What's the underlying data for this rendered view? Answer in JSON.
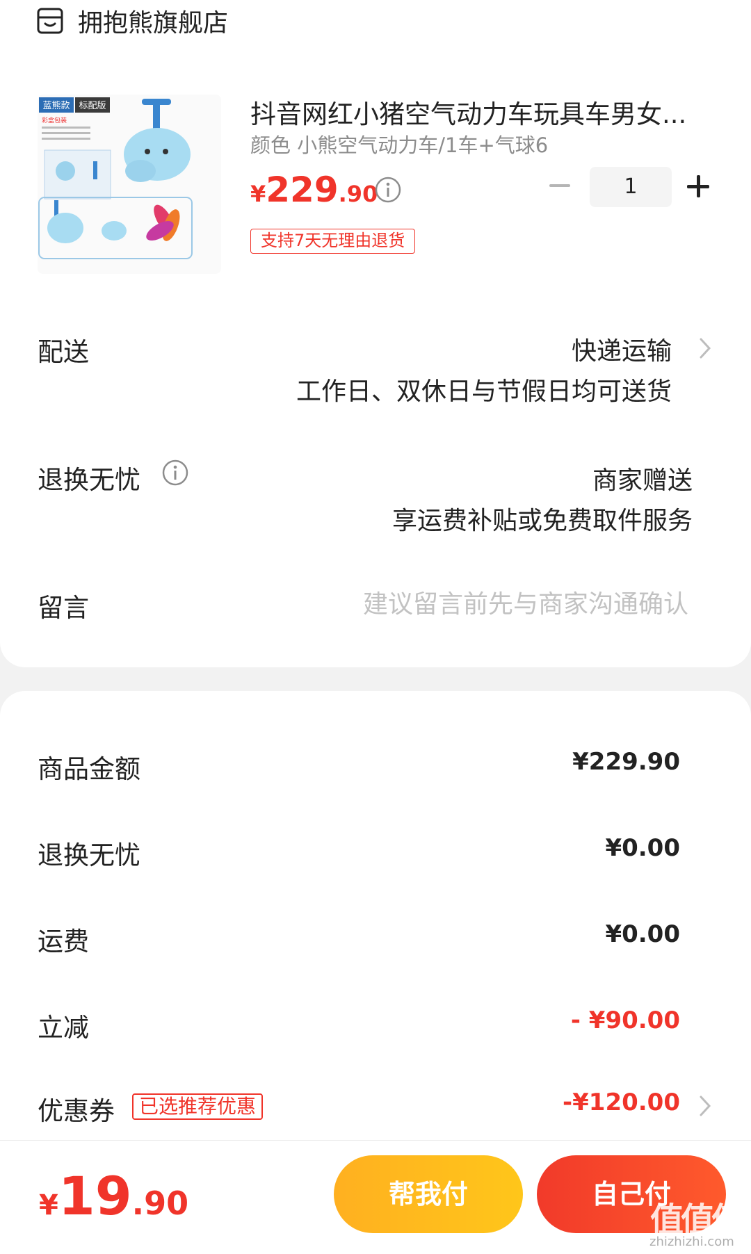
{
  "shop": {
    "name": "拥抱熊旗舰店",
    "icon": "store-icon"
  },
  "product": {
    "title": "抖音网红小猪空气动力车玩具车男女...",
    "spec": "颜色 小熊空气动力车/1车+气球6",
    "price_currency": "¥",
    "price_int": "229",
    "price_dec": ".90",
    "return_tag": "支持7天无理由退货",
    "quantity": "1",
    "image_labels": {
      "badge_a": "蓝熊款",
      "badge_b": "标配版",
      "box": "彩盒包装"
    }
  },
  "delivery": {
    "label": "配送",
    "method": "快递运输",
    "note": "工作日、双休日与节假日均可送货"
  },
  "return_service": {
    "label": "退换无忧",
    "value": "商家赠送",
    "note": "享运费补贴或免费取件服务"
  },
  "message": {
    "label": "留言",
    "placeholder": "建议留言前先与商家沟通确认"
  },
  "summary": {
    "goods_label": "商品金额",
    "goods_value": "¥229.90",
    "return_label": "退换无忧",
    "return_value": "¥0.00",
    "shipping_label": "运费",
    "shipping_value": "¥0.00",
    "discount_label": "立减",
    "discount_value": "- ¥90.00",
    "coupon_label": "优惠券",
    "coupon_tag": "已选推荐优惠",
    "coupon_value": "-¥120.00"
  },
  "footer": {
    "total_currency": "¥",
    "total_int": "19",
    "total_dec": ".90",
    "help_pay": "帮我付",
    "self_pay": "自己付"
  },
  "watermark": {
    "main": "值值值",
    "sub": "zhizhizhi.com"
  },
  "colors": {
    "accent": "#f0342a",
    "help_button": "#ffbb1c",
    "self_button": "#f5412b"
  }
}
